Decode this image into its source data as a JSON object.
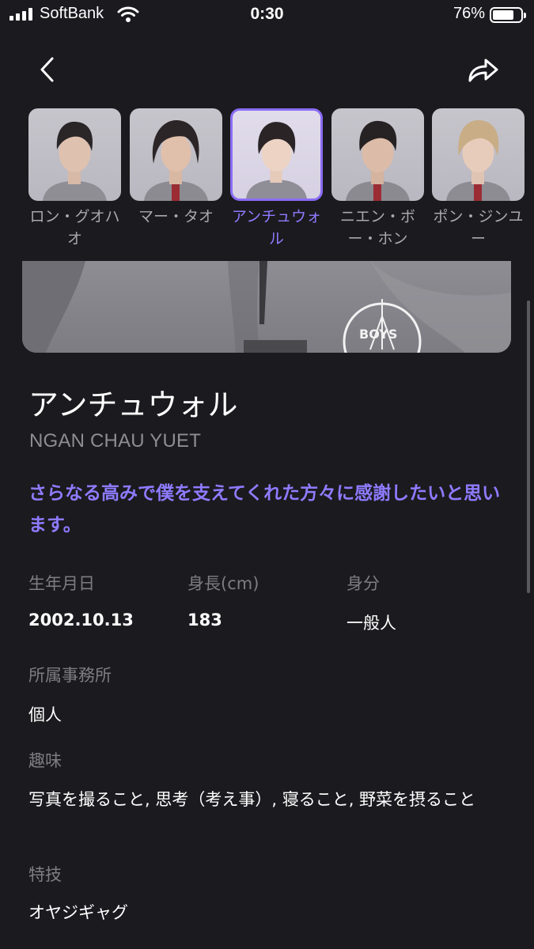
{
  "status_bar": {
    "carrier": "SoftBank",
    "time": "0:30",
    "battery": "76%"
  },
  "carousel": {
    "members": [
      {
        "name": "ロン・グオハオ",
        "selected": false
      },
      {
        "name": "マー・タオ",
        "selected": false
      },
      {
        "name": "アンチュウォル",
        "selected": true
      },
      {
        "name": "ニエン・ボー・ホン",
        "selected": false
      },
      {
        "name": "ポン・ジンユー",
        "selected": false
      }
    ]
  },
  "profile": {
    "name": "アンチュウォル",
    "romanized": "NGAN CHAU YUET",
    "quote": "さらなる高みで僕を支えてくれた方々に感謝したいと思います。",
    "birthday_label": "生年月日",
    "birthday": "2002.10.13",
    "height_label": "身長(cm)",
    "height": "183",
    "status_label": "身分",
    "status": "一般人",
    "agency_label": "所属事務所",
    "agency": "個人",
    "hobby_label": "趣味",
    "hobby": "写真を撮ること, 思考（考え事）, 寝ること, 野菜を摂ること",
    "skill_label": "特技",
    "skill": "オヤジギャグ"
  },
  "colors": {
    "background": "#1b1a1e",
    "accent": "#8e7bff",
    "muted": "#7e7d83"
  }
}
